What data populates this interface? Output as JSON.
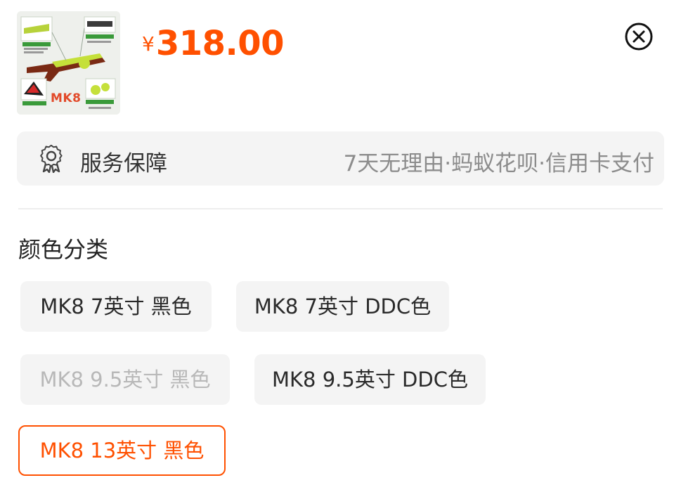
{
  "product": {
    "thumbnail_label": "MK8",
    "currency_symbol": "¥",
    "price": "318.00"
  },
  "service": {
    "icon": "badge-ribbon-icon",
    "title": "服务保障",
    "detail": "7天无理由·蚂蚁花呗·信用卡支付"
  },
  "options": {
    "section_title": "颜色分类",
    "items": [
      {
        "label": "MK8 7英寸 黑色",
        "state": "normal"
      },
      {
        "label": "MK8 7英寸 DDC色",
        "state": "normal"
      },
      {
        "label": "MK8 9.5英寸 黑色",
        "state": "disabled"
      },
      {
        "label": "MK8 9.5英寸 DDC色",
        "state": "normal"
      },
      {
        "label": "MK8 13英寸 黑色",
        "state": "selected"
      }
    ]
  },
  "colors": {
    "accent": "#ff5000",
    "chip_background": "#f4f4f4",
    "disabled_text": "#b8b8b8"
  }
}
